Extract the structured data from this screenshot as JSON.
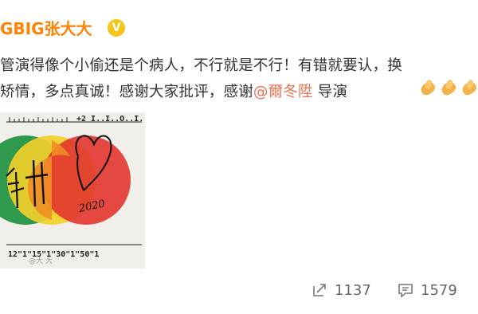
{
  "post": {
    "author": "GBIG张大大",
    "vip_icon": "verified-badge-icon",
    "text_line1": "管演得像个小偷还是个病人，不行就是不行！有错就要认，换",
    "text_line2_before": "矫情，多点真诚！感谢大家批评，感谢",
    "mention": "@爾冬陞",
    "text_line2_after": " 导演",
    "emojis": [
      "clasped-hands-icon",
      "clasped-hands-icon",
      "clasped-hands-icon"
    ]
  },
  "image": {
    "top_ruler_text": "+2 I..I..O..I..I",
    "bottom_ruler_text": "12\"1\"15\"1\"30\"1\"50\"1",
    "signature_year": "2020",
    "caption": "@大 大"
  },
  "actions": {
    "forward_icon": "forward-icon",
    "forward_count": "1137",
    "comment_icon": "comment-icon",
    "comment_count": "1579"
  },
  "colors": {
    "author": "#ff8200",
    "mention": "#eb7350",
    "vip": "#f5c518"
  }
}
